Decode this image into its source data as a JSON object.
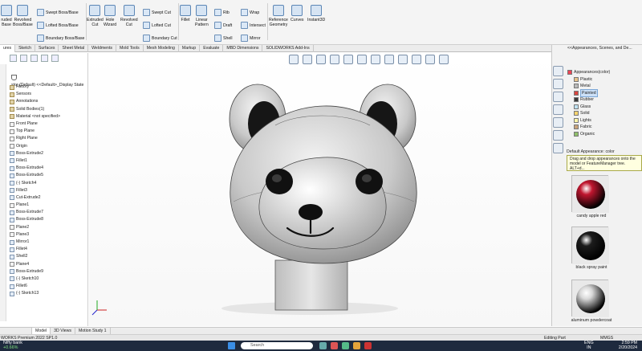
{
  "ribbon": {
    "extruded_boss": "ruded\nBase",
    "revolved_boss": "Revolved\nBoss/Base",
    "swept_boss": "Swept Boss/Base",
    "lofted_boss": "Lofted Boss/Base",
    "boundary_boss": "Boundary Boss/Base",
    "extruded_cut": "Extruded\nCut",
    "hole_wizard": "Hole\nWizard",
    "revolved_cut": "Revolved\nCut",
    "swept_cut": "Swept Cut",
    "lofted_cut": "Lofted Cut",
    "boundary_cut": "Boundary Cut",
    "fillet": "Fillet",
    "linear_pattern": "Linear\nPattern",
    "rib": "Rib",
    "draft": "Draft",
    "shell": "Shell",
    "wrap": "Wrap",
    "intersect": "Intersect",
    "mirror": "Mirror",
    "reference_geometry": "Reference\nGeometry",
    "curves": "Curves",
    "instant3d": "Instant3D"
  },
  "command_tabs": [
    "ures",
    "Sketch",
    "Surfaces",
    "Sheet Metal",
    "Weldments",
    "Mold Tools",
    "Mesh Modeling",
    "Markup",
    "Evaluate",
    "MBD Dimensions",
    "SOLIDWORKS Add-Ins"
  ],
  "tree": {
    "root": "stor (Default) <<Default>_Display State",
    "items": [
      {
        "label": "History",
        "icon": "history-folder-icon",
        "type": "fe"
      },
      {
        "label": "Sensors",
        "icon": "sensor-icon",
        "type": "fe"
      },
      {
        "label": "Annotations",
        "icon": "annotation-icon",
        "type": "fe"
      },
      {
        "label": "Solid Bodies(1)",
        "icon": "solid-body-icon",
        "type": "fe"
      },
      {
        "label": "Material <not specified>",
        "icon": "material-icon",
        "type": "fe"
      },
      {
        "label": "Front Plane",
        "icon": "plane-icon",
        "type": "pl"
      },
      {
        "label": "Top Plane",
        "icon": "plane-icon",
        "type": "pl"
      },
      {
        "label": "Right Plane",
        "icon": "plane-icon",
        "type": "pl"
      },
      {
        "label": "Origin",
        "icon": "origin-icon",
        "type": "pl"
      },
      {
        "label": "Boss-Extrude2",
        "icon": "extrude-icon",
        "type": "x"
      },
      {
        "label": "Fillet1",
        "icon": "fillet-icon",
        "type": "x"
      },
      {
        "label": "Boss-Extrude4",
        "icon": "extrude-icon",
        "type": "x"
      },
      {
        "label": "Boss-Extrude5",
        "icon": "extrude-icon",
        "type": "x"
      },
      {
        "label": "(-) Sketch4",
        "icon": "sketch-icon",
        "type": "x"
      },
      {
        "label": "Fillet3",
        "icon": "fillet-icon",
        "type": "x"
      },
      {
        "label": "Cut-Extrude2",
        "icon": "cut-extrude-icon",
        "type": "x"
      },
      {
        "label": "Plane1",
        "icon": "plane-icon",
        "type": "pl"
      },
      {
        "label": "Boss-Extrude7",
        "icon": "extrude-icon",
        "type": "x"
      },
      {
        "label": "Boss-Extrude8",
        "icon": "extrude-icon",
        "type": "x"
      },
      {
        "label": "Plane2",
        "icon": "plane-icon",
        "type": "pl"
      },
      {
        "label": "Plane3",
        "icon": "plane-icon",
        "type": "pl"
      },
      {
        "label": "Mirror1",
        "icon": "mirror-icon",
        "type": "x"
      },
      {
        "label": "Fillet4",
        "icon": "fillet-icon",
        "type": "x"
      },
      {
        "label": "Shell2",
        "icon": "shell-icon",
        "type": "x"
      },
      {
        "label": "Plane4",
        "icon": "plane-icon",
        "type": "pl"
      },
      {
        "label": "Boss-Extrude9",
        "icon": "extrude-icon",
        "type": "x"
      },
      {
        "label": "(-) Sketch10",
        "icon": "sketch-icon",
        "type": "x"
      },
      {
        "label": "Fillet6",
        "icon": "fillet-icon",
        "type": "x"
      },
      {
        "label": "(-) Sketch13",
        "icon": "sketch-icon",
        "type": "x"
      }
    ]
  },
  "taskpane": {
    "title": "<<Appearances, Scenes, and De...",
    "root": "Appearances(color)",
    "items": [
      {
        "label": "Plastic",
        "color": "#e7c38a"
      },
      {
        "label": "Metal",
        "color": "#b9b9b9"
      },
      {
        "label": "Painted",
        "color": "#d8453f",
        "selected": true
      },
      {
        "label": "Rubber",
        "color": "#3a3a3a"
      },
      {
        "label": "Glass",
        "color": "#bfe2f2"
      },
      {
        "label": "Solid",
        "color": "#f6d36e"
      },
      {
        "label": "Lights",
        "color": "#fff6a8"
      },
      {
        "label": "Fabric",
        "color": "#c9a27a"
      },
      {
        "label": "Organic",
        "color": "#8fbf6a"
      }
    ],
    "default_appearance": "Default Appearance: color",
    "tooltip": "Drag and drop appearances onto the model or FeatureManager tree. ALT+d...",
    "swatches": [
      {
        "label": "candy apple red",
        "color": "#c0162f"
      },
      {
        "label": "black spray paint",
        "color": "#1c1c1c"
      },
      {
        "label": "aluminum powdercoat",
        "color": "#d8d8d8"
      }
    ]
  },
  "bottom_tabs": [
    "Model",
    "3D Views",
    "Motion Study 1"
  ],
  "status": {
    "product": "WORKS Premium 2022 SP1.0",
    "mode": "Editing Part",
    "units": "MMGS"
  },
  "taskbar": {
    "weather": "Nifty bank",
    "weather_sub": "+0.66%",
    "search": "Search",
    "lang": "ENG",
    "region": "IN",
    "time": "2:59 PM",
    "date": "2/20/2024"
  },
  "colors": {
    "accent": "#2b67b3",
    "model": "#c8c8c8",
    "tooltip_bg": "#ffffe0"
  }
}
